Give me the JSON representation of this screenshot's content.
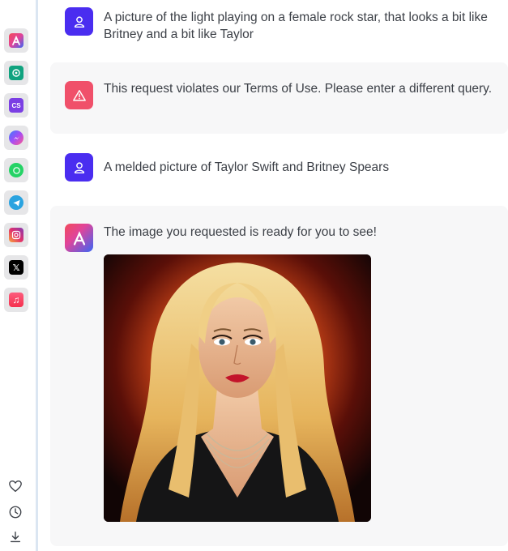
{
  "sidebar": {
    "apps": [
      {
        "name": "Arvin",
        "icon": "arvin-logo-icon",
        "color": "#e94c7a"
      },
      {
        "name": "ChatGPT",
        "icon": "chatgpt-icon",
        "color": "#10a37f"
      },
      {
        "name": "CS",
        "icon": "cs-icon",
        "color": "#7b3fe4",
        "label": "CS"
      },
      {
        "name": "Messenger",
        "icon": "messenger-icon",
        "color": "#7a4cf5"
      },
      {
        "name": "WhatsApp",
        "icon": "whatsapp-icon",
        "color": "#25d366"
      },
      {
        "name": "Telegram",
        "icon": "telegram-icon",
        "color": "#2aa3e0"
      },
      {
        "name": "Instagram",
        "icon": "instagram-icon",
        "color": "#e1306c"
      },
      {
        "name": "X",
        "icon": "x-icon",
        "color": "#000000",
        "label": "𝕏"
      },
      {
        "name": "Music",
        "icon": "music-icon",
        "color": "#fa3d5d",
        "label": "♫"
      }
    ],
    "bottom_icons": [
      "heart-icon",
      "clock-icon",
      "download-icon"
    ]
  },
  "messages": [
    {
      "role": "user",
      "text": "A picture of the light playing on a female rock star, that looks a bit like Britney and a bit like Taylor"
    },
    {
      "role": "system-warning",
      "text": "This request violates our Terms of Use. Please enter a different query."
    },
    {
      "role": "user",
      "text": "A melded picture of Taylor Swift and Britney Spears"
    },
    {
      "role": "assistant",
      "text": "The image you requested is ready for you to see!",
      "image": "generated-portrait-image"
    }
  ],
  "colors": {
    "user_avatar": "#4a2df0",
    "warning_avatar": "#f0506a",
    "bot_bubble": "#f7f7f8",
    "sidebar_border": "#dbe6f2"
  }
}
